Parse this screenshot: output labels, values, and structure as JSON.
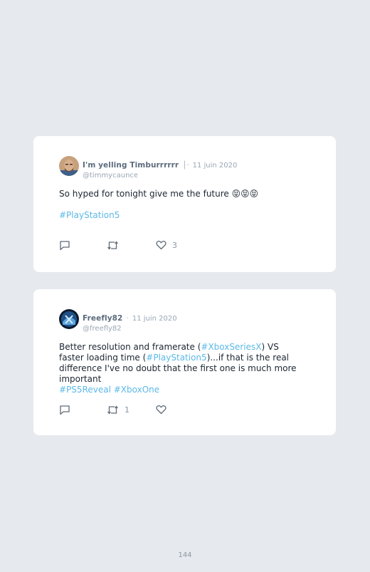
{
  "tweets": [
    {
      "author_name": "I'm yelling Timburrrrrr",
      "separator": "│·",
      "date": "11 juin 2020",
      "handle": "@timmycaunce",
      "text": "So hyped for tonight give me the future 😝😝😝",
      "hashtag": "#PlayStation5",
      "replies_count": "",
      "retweets_count": "",
      "likes_count": "3"
    },
    {
      "author_name": "Freefly82",
      "separator": "·",
      "date": "11 juin 2020",
      "handle": "@freefly82",
      "text_1": "Better resolution and framerate (",
      "hashtag_1": "#XboxSeriesX",
      "text_2": ") VS faster loading time (",
      "hashtag_2": "#PlayStation5",
      "text_3": ")...if that is the real difference I've no doubt that the first one is much more important",
      "hashtag_3": "#PS5Reveal",
      "hashtag_4": "#XboxOne",
      "replies_count": "",
      "retweets_count": "1",
      "likes_count": ""
    }
  ],
  "page_number": "144",
  "colors": {
    "background": "#e6e9ed",
    "card": "#ffffff",
    "link": "#5bb8e8",
    "name": "#5b6b7d",
    "meta": "#9aa7b4",
    "icon": "#5d6b78"
  }
}
